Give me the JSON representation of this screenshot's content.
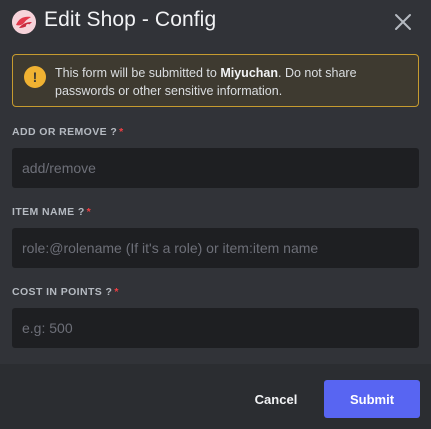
{
  "modal": {
    "title": "Edit Shop - Config",
    "app_icon": "miyuchan-avatar-icon",
    "close_icon": "close-icon"
  },
  "warning": {
    "icon": "warning-icon",
    "icon_glyph": "!",
    "text_prefix": "This form will be submitted to ",
    "app_name": "Miyuchan",
    "text_suffix": ". Do not share passwords or other sensitive information."
  },
  "fields": [
    {
      "label": "ADD OR REMOVE ?",
      "required_mark": "*",
      "placeholder": "add/remove",
      "value": ""
    },
    {
      "label": "ITEM NAME ?",
      "required_mark": "*",
      "placeholder": "role:@rolename (If it's a role) or item:item name",
      "value": ""
    },
    {
      "label": "COST IN POINTS ?",
      "required_mark": "*",
      "placeholder": "e.g: 500",
      "value": ""
    }
  ],
  "footer": {
    "cancel_label": "Cancel",
    "submit_label": "Submit"
  },
  "colors": {
    "background": "#313338",
    "footer_background": "#2b2d31",
    "input_background": "#1e1f22",
    "warning_border": "#c69b2f",
    "warning_icon": "#f0b232",
    "required": "#f23f43",
    "submit": "#5865f2"
  }
}
